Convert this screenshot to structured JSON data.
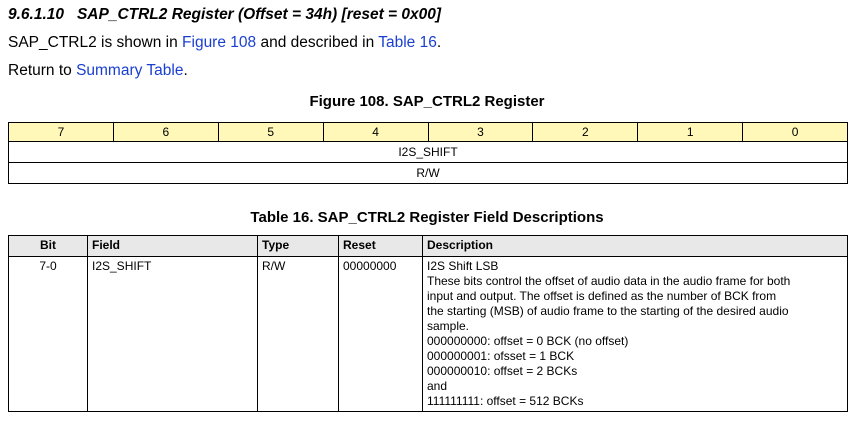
{
  "heading": {
    "number": "9.6.1.10",
    "title": "SAP_CTRL2 Register (Offset = 34h) [reset = 0x00]"
  },
  "intro": {
    "part1": "SAP_CTRL2 is shown in ",
    "figure_link": "Figure 108",
    "part2": " and described in ",
    "table_link": "Table 16",
    "part3": "."
  },
  "return": {
    "prefix": "Return to ",
    "link": "Summary Table",
    "suffix": "."
  },
  "figure": {
    "caption": "Figure 108.  SAP_CTRL2 Register",
    "bits": [
      "7",
      "6",
      "5",
      "4",
      "3",
      "2",
      "1",
      "0"
    ],
    "field": "I2S_SHIFT",
    "access": "R/W"
  },
  "table": {
    "caption": "Table 16. SAP_CTRL2 Register Field Descriptions",
    "headers": {
      "bit": "Bit",
      "field": "Field",
      "type": "Type",
      "reset": "Reset",
      "description": "Description"
    },
    "row": {
      "bit": "7-0",
      "field": "I2S_SHIFT",
      "type": "R/W",
      "reset": "00000000",
      "description": [
        "I2S Shift LSB",
        "These bits control the offset of audio data in the audio frame for both",
        "input and output. The offset is defined as the number of BCK from",
        "the starting (MSB) of audio frame to the starting of the desired audio",
        "sample.",
        "000000000: offset = 0 BCK (no offset)",
        "000000001: ofsset = 1 BCK",
        "000000010: offset = 2 BCKs",
        "and",
        "111111111: offset = 512 BCKs"
      ]
    }
  },
  "colors": {
    "link": "#1a3fd0",
    "bit_row_bg": "#fff8b8",
    "header_bg": "#e8e8e8"
  }
}
